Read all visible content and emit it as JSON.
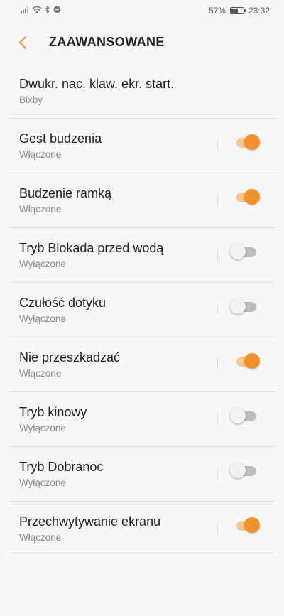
{
  "status_bar": {
    "battery_text": "57%",
    "time": "23:32",
    "battery_level": 0.57
  },
  "header": {
    "title": "ZAAWANSOWANE",
    "back_icon": "chevron-left-icon"
  },
  "colors": {
    "accent": "#f0912a",
    "accent_track": "#f6c590"
  },
  "settings": [
    {
      "label": "Dwukr. nac. klaw. ekr. start.",
      "status": "Bixby",
      "toggle": null
    },
    {
      "label": "Gest budzenia",
      "status": "Włączone",
      "toggle": true
    },
    {
      "label": "Budzenie ramką",
      "status": "Włączone",
      "toggle": true
    },
    {
      "label": "Tryb Blokada przed wodą",
      "status": "Wyłączone",
      "toggle": false
    },
    {
      "label": "Czułość dotyku",
      "status": "Wyłączone",
      "toggle": false
    },
    {
      "label": "Nie przeszkadzać",
      "status": "Włączone",
      "toggle": true
    },
    {
      "label": "Tryb kinowy",
      "status": "Wyłączone",
      "toggle": false
    },
    {
      "label": "Tryb Dobranoc",
      "status": "Wyłączone",
      "toggle": false
    },
    {
      "label": "Przechwytywanie ekranu",
      "status": "Włączone",
      "toggle": true
    }
  ]
}
